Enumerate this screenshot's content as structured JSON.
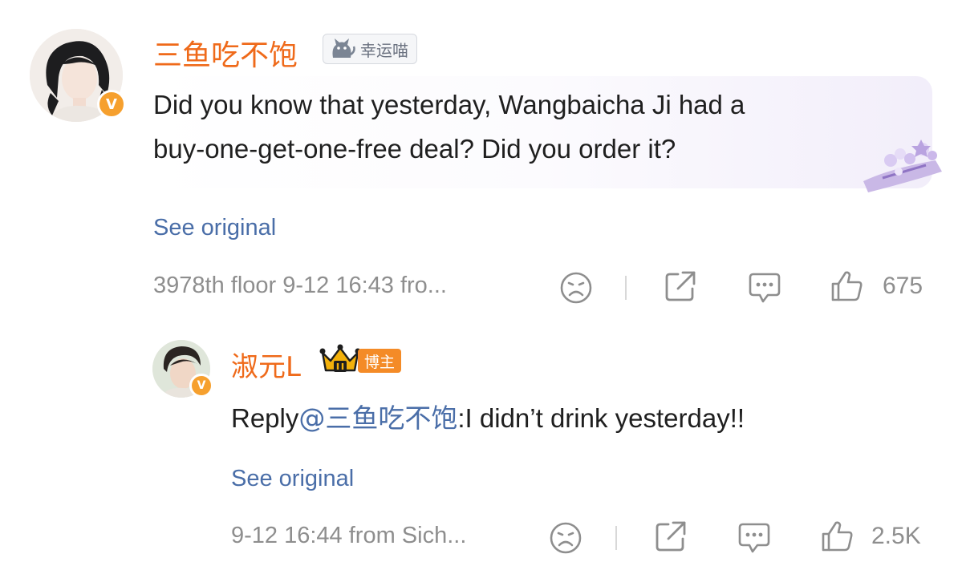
{
  "comment": {
    "username": "三鱼吃不饱",
    "tag": "幸运喵",
    "text_line1": "Did you know that yesterday, Wangbaicha Ji had a",
    "text_line2": "buy-one-get-one-free deal? Did you order it?",
    "see_original": "See original",
    "meta": "3978th floor  9-12 16:43  fro...",
    "likes": "675",
    "verified_badge": "V"
  },
  "reply": {
    "username": "淑元L",
    "badge_label": "博主",
    "reply_prefix": "Reply",
    "mention": "@三鱼吃不饱",
    "reply_text": ":I didn’t drink yesterday!!",
    "see_original": "See original",
    "meta": "9-12 16:44  from Sich...",
    "likes": "2.5K",
    "verified_badge": "V"
  },
  "colors": {
    "username": "#ef6a1a",
    "link": "#4a6ea8",
    "meta": "#8e8e8e",
    "badge": "#f6a02e"
  }
}
